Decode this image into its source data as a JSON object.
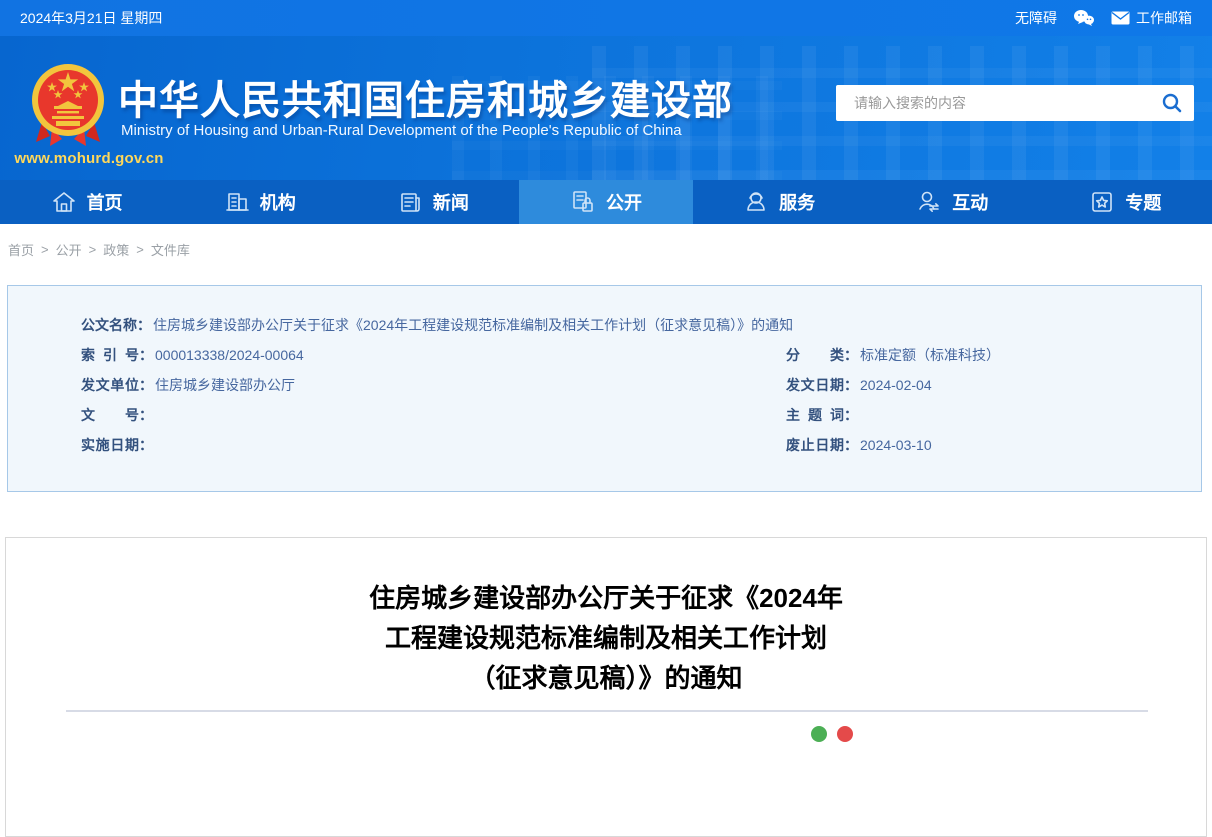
{
  "topbar": {
    "date": "2024年3月21日 星期四",
    "accessibility_label": "无障碍",
    "mailbox_label": "工作邮箱"
  },
  "header": {
    "site_title": "中华人民共和国住房和城乡建设部",
    "site_subtitle": "Ministry of Housing and Urban-Rural Development of the People's Republic of China",
    "site_url": "www.mohurd.gov.cn",
    "search_placeholder": "请输入搜索的内容"
  },
  "nav": {
    "items": [
      {
        "label": "首页",
        "icon": "home-icon",
        "active": false
      },
      {
        "label": "机构",
        "icon": "building-icon",
        "active": false
      },
      {
        "label": "新闻",
        "icon": "news-icon",
        "active": false
      },
      {
        "label": "公开",
        "icon": "disclosure-lock-icon",
        "active": true
      },
      {
        "label": "服务",
        "icon": "service-agent-icon",
        "active": false
      },
      {
        "label": "互动",
        "icon": "interaction-icon",
        "active": false
      },
      {
        "label": "专题",
        "icon": "star-badge-icon",
        "active": false
      }
    ]
  },
  "breadcrumb": {
    "separator": ">",
    "items": [
      "首页",
      "公开",
      "政策",
      "文件库"
    ]
  },
  "meta_box": {
    "colon": "：",
    "left": [
      {
        "label": "公文名称",
        "value": "住房城乡建设部办公厅关于征求《2024年工程建设规范标准编制及相关工作计划（征求意见稿）》的通知"
      },
      {
        "label": "索引号",
        "value": "000013338/2024-00064"
      },
      {
        "label": "发文单位",
        "value": "住房城乡建设部办公厅"
      },
      {
        "label": "文号",
        "value": ""
      },
      {
        "label": "实施日期",
        "value": ""
      }
    ],
    "right": [
      {
        "label": "分类",
        "value": "标准定额（标准科技）"
      },
      {
        "label": "发文日期",
        "value": "2024-02-04"
      },
      {
        "label": "主题词",
        "value": ""
      },
      {
        "label": "废止日期",
        "value": "2024-03-10"
      }
    ]
  },
  "article": {
    "title_lines": [
      "住房城乡建设部办公厅关于征求《2024年",
      "工程建设规范标准编制及相关工作计划",
      "（征求意见稿）》的通知"
    ]
  },
  "colors": {
    "topbar_blue": "#0f78e8",
    "header_blue": "#0c72da",
    "nav_blue": "#0a60c2",
    "nav_active_blue": "#2e8bdc",
    "meta_box_bg": "#f1f7fc",
    "meta_box_border": "#a6c8e8",
    "meta_label_text": "#33517e",
    "meta_value_text": "#46679f",
    "gold_url": "#ffd85a",
    "share_green": "#4caf55",
    "share_red": "#e44a4a"
  }
}
